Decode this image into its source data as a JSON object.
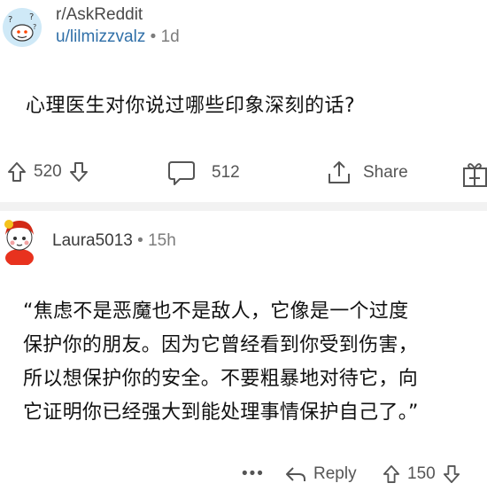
{
  "post": {
    "subreddit": "r/AskReddit",
    "username": "u/lilmizzvalz",
    "separator": "•",
    "age": "1d",
    "title": "心理医生对你说过哪些印象深刻的话?",
    "upvotes": "520",
    "comments": "512",
    "share_label": "Share"
  },
  "comment": {
    "author": "Laura5013",
    "separator": "•",
    "age": "15h",
    "lines": [
      "“焦虑不是恶魔也不是敌人，它像是一个过度",
      "保护你的朋友。因为它曾经看到你受到伤害，",
      "所以想保护你的安全。不要粗暴地对待它，向",
      "它证明你已经强大到能处理事情保护自己了。”"
    ],
    "more_label": "•••",
    "reply_label": "Reply",
    "votes": "150"
  },
  "colors": {
    "username_link": "#2f6fa8",
    "meta_gray": "#7c7c7c",
    "icon_gray": "#555555",
    "avatar_bg": "#cfe9f7"
  },
  "icons": {
    "subreddit_avatar": "snoo-question-avatar-icon",
    "upvote": "arrow-up-icon",
    "downvote": "arrow-down-icon",
    "comment": "speech-bubble-icon",
    "share": "share-icon",
    "award": "gift-icon",
    "reply": "reply-arrow-icon"
  }
}
